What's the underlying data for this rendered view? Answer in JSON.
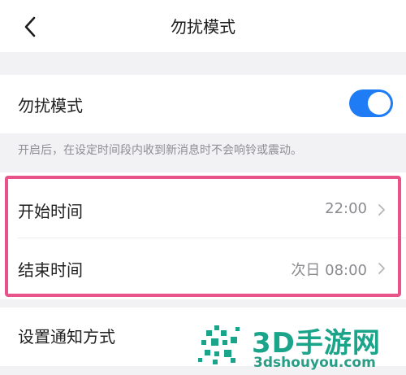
{
  "nav": {
    "title": "勿扰模式",
    "back_icon": "chevron-left-icon"
  },
  "dnd": {
    "label": "勿扰模式",
    "enabled": true,
    "toggle_color": "#1f7cf5",
    "hint": "开启后，在设定时间段内收到新消息时不会响铃或震动。"
  },
  "schedule": {
    "start": {
      "label": "开始时间",
      "value": "22:00"
    },
    "end": {
      "label": "结束时间",
      "value": "次日 08:00"
    },
    "highlight_color": "#e8538a"
  },
  "notify": {
    "label": "设置通知方式"
  },
  "watermark": {
    "brand": "3D手游网",
    "domain": "3dshouyou.com",
    "color": "#1aa58a"
  }
}
